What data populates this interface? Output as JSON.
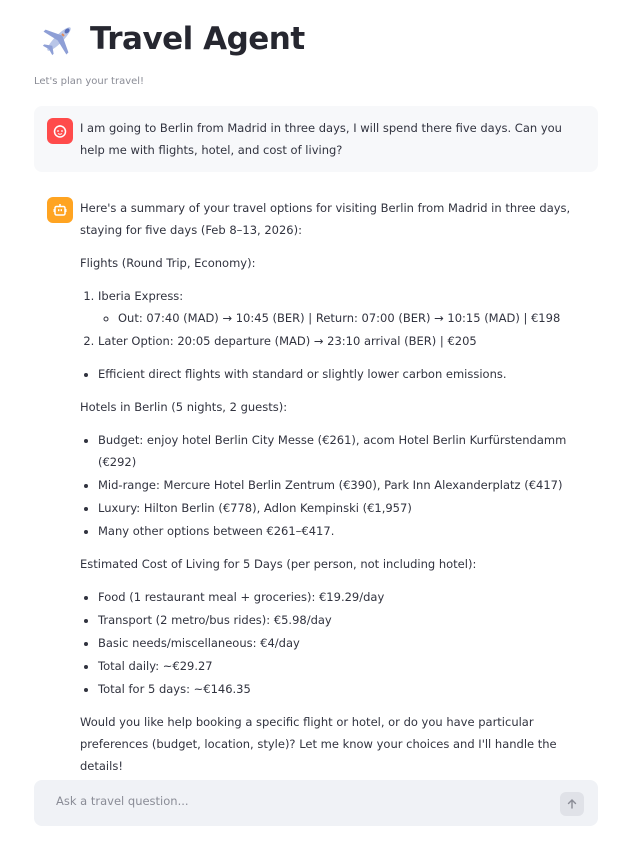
{
  "header": {
    "title": "Travel Agent",
    "caption": "Let's plan your travel!"
  },
  "user_message": "I am going to Berlin from Madrid in three days, I will spend there five days. Can you help me with flights, hotel, and cost of living?",
  "assistant_message": {
    "intro": "Here's a summary of your travel options for visiting Berlin from Madrid in three days, staying for five days (Feb 8–13, 2026):",
    "flights_heading": "Flights (Round Trip, Economy):",
    "flights": [
      {
        "label": "Iberia Express:",
        "detail": "Out: 07:40 (MAD) → 10:45 (BER) | Return: 07:00 (BER) → 10:15 (MAD) | €198"
      },
      {
        "label": "Later Option: 20:05 departure (MAD) → 23:10 arrival (BER) | €205"
      }
    ],
    "flights_note": "Efficient direct flights with standard or slightly lower carbon emissions.",
    "hotels_heading": "Hotels in Berlin (5 nights, 2 guests):",
    "hotels": [
      "Budget: enjoy hotel Berlin City Messe (€261), acom Hotel Berlin Kurfürstendamm (€292)",
      "Mid-range: Mercure Hotel Berlin Zentrum (€390), Park Inn Alexanderplatz (€417)",
      "Luxury: Hilton Berlin (€778), Adlon Kempinski (€1,957)",
      "Many other options between €261–€417."
    ],
    "cost_heading": "Estimated Cost of Living for 5 Days (per person, not including hotel):",
    "costs": [
      "Food (1 restaurant meal + groceries): €19.29/day",
      "Transport (2 metro/bus rides): €5.98/day",
      "Basic needs/miscellaneous: €4/day",
      "Total daily: ~€29.27",
      "Total for 5 days: ~€146.35"
    ],
    "closing": "Would you like help booking a specific flight or hotel, or do you have particular preferences (budget, location, style)? Let me know your choices and I'll handle the details!"
  },
  "input": {
    "placeholder": "Ask a travel question..."
  },
  "icons": {
    "header": "airplane-icon",
    "user_avatar": "user-face-icon",
    "bot_avatar": "robot-icon",
    "send": "arrow-up-icon"
  },
  "colors": {
    "user_avatar": "#ff4b4b",
    "bot_avatar": "#ffa421",
    "user_bubble": "#f7f8fa",
    "input_bg": "#f0f2f6"
  }
}
